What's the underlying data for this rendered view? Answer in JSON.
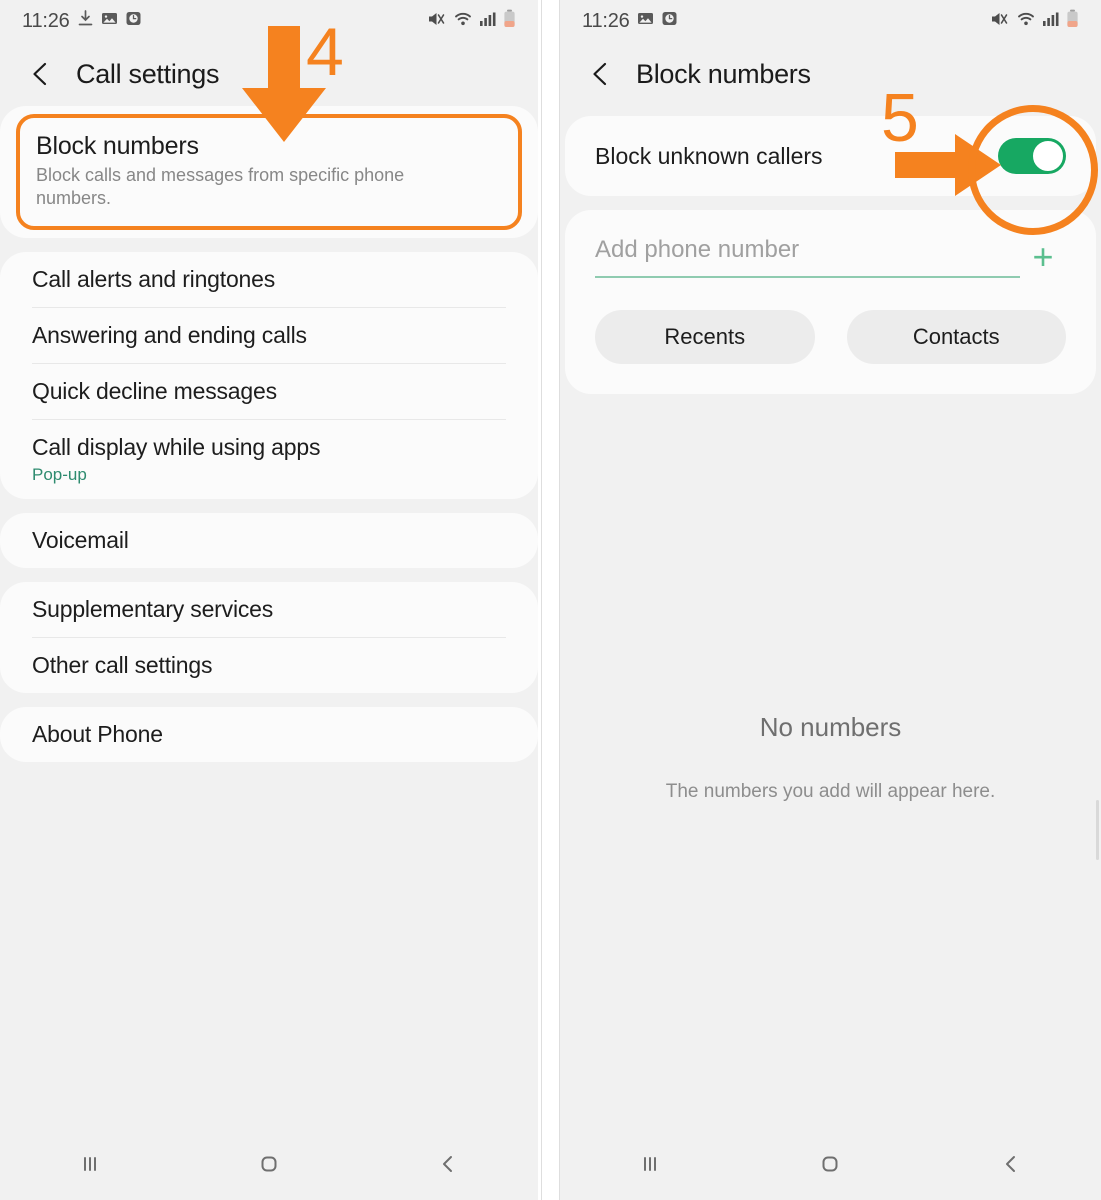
{
  "left_screen": {
    "status_bar": {
      "time": "11:26",
      "left_icons": [
        "download-icon",
        "image-icon",
        "alarm-icon"
      ],
      "right_icons": [
        "mute-icon",
        "wifi-icon",
        "signal-icon",
        "battery-icon"
      ]
    },
    "title": "Call settings",
    "back_icon": "back-chevron-icon",
    "highlighted_item": {
      "label": "Block numbers",
      "description": "Block calls and messages from specific phone numbers."
    },
    "groups": [
      {
        "items": [
          {
            "label": "Call alerts and ringtones",
            "value": ""
          },
          {
            "label": "Answering and ending calls",
            "value": ""
          },
          {
            "label": "Quick decline messages",
            "value": ""
          },
          {
            "label": "Call display while using apps",
            "value": "Pop-up"
          }
        ]
      },
      {
        "items": [
          {
            "label": "Voicemail",
            "value": ""
          }
        ]
      },
      {
        "items": [
          {
            "label": "Supplementary services",
            "value": ""
          },
          {
            "label": "Other call settings",
            "value": ""
          }
        ]
      },
      {
        "items": [
          {
            "label": "About Phone",
            "value": ""
          }
        ]
      }
    ],
    "nav": {
      "recents": "recents-icon",
      "home": "home-icon",
      "back": "back-icon"
    },
    "annotation": {
      "number": "4",
      "arrow": "down-arrow"
    }
  },
  "right_screen": {
    "status_bar": {
      "time": "11:26",
      "left_icons": [
        "image-icon",
        "alarm-icon"
      ],
      "right_icons": [
        "mute-icon",
        "wifi-icon",
        "signal-icon",
        "battery-icon"
      ]
    },
    "title": "Block numbers",
    "back_icon": "back-chevron-icon",
    "toggle_row": {
      "label": "Block unknown callers",
      "state": "on"
    },
    "add_number": {
      "placeholder": "Add phone number",
      "value": "",
      "plus_icon": "plus-icon",
      "chips": [
        "Recents",
        "Contacts"
      ]
    },
    "empty_state": {
      "title": "No numbers",
      "subtitle": "The numbers you add will appear here."
    },
    "nav": {
      "recents": "recents-icon",
      "home": "home-icon",
      "back": "back-icon"
    },
    "annotation": {
      "number": "5",
      "arrow": "right-arrow",
      "highlight": "circle"
    }
  },
  "colors": {
    "accent_orange": "#f5821f",
    "toggle_green": "#17a862",
    "field_green": "#8fcbb0",
    "value_green": "#2e8b6f",
    "background": "#f1f1f1",
    "card": "#fbfbfb"
  }
}
